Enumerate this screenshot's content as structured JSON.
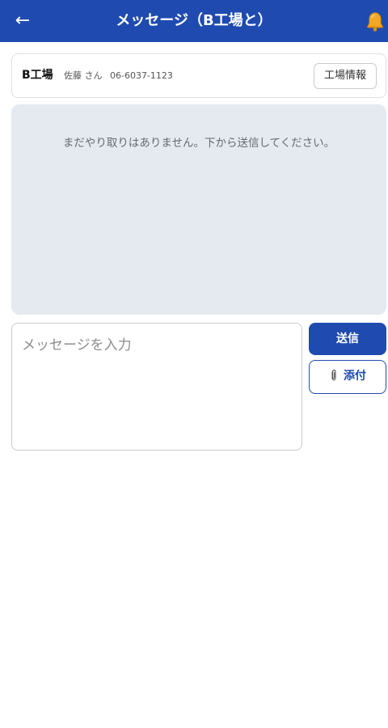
{
  "header": {
    "back_icon": "←",
    "title": "メッセージ（B工場と）",
    "bell_icon": "bell-icon",
    "background_color": "#1f4bb0"
  },
  "factory": {
    "name": "B工場",
    "contact": "佐藤 さん",
    "phone": "06-6037-1123",
    "info_button_label": "工場情報"
  },
  "messages": {
    "empty_text": "まだやり取りはありません。下から送信してください。",
    "items": []
  },
  "composer": {
    "placeholder": "メッセージを入力",
    "value": "",
    "send_label": "送信",
    "attach_icon": "paperclip-icon",
    "attach_label": "添付"
  }
}
